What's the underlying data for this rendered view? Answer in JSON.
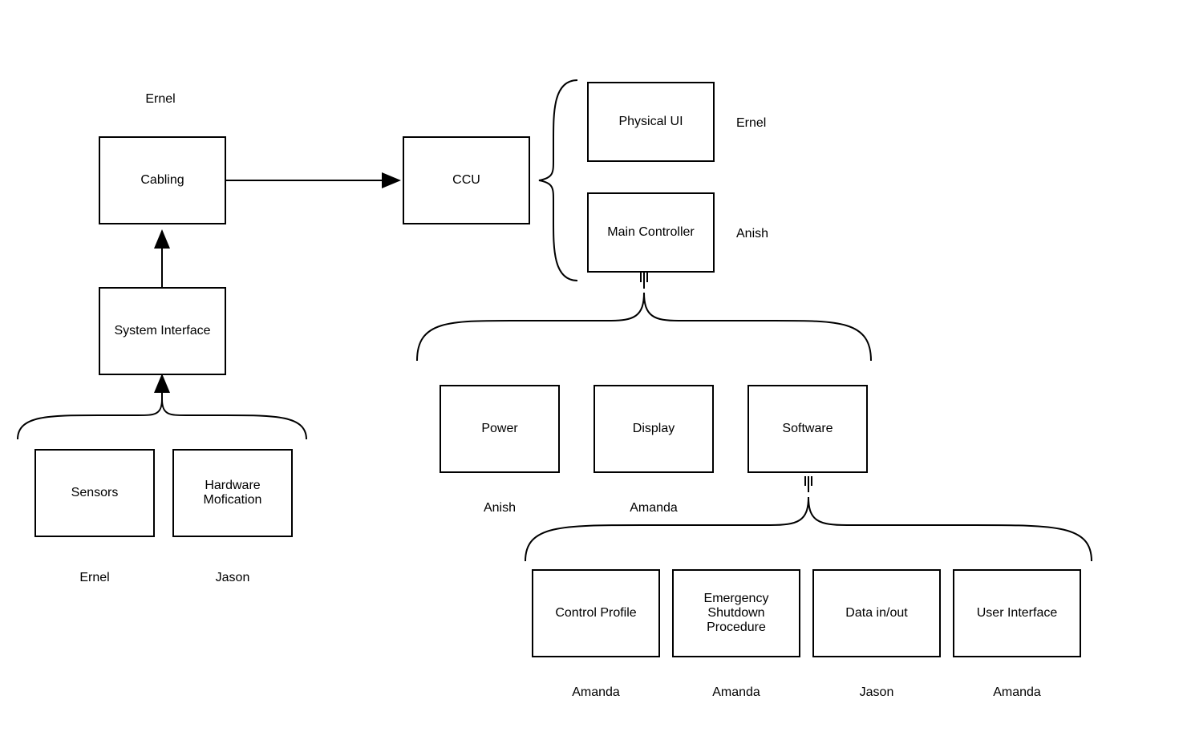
{
  "nodes": {
    "cabling": {
      "label": "Cabling",
      "owner": "Ernel"
    },
    "system_interface": {
      "label": "System Interface"
    },
    "sensors": {
      "label": "Sensors",
      "owner": "Ernel"
    },
    "hardware_mod": {
      "label": "Hardware Mofication",
      "owner": "Jason"
    },
    "ccu": {
      "label": "CCU"
    },
    "physical_ui": {
      "label": "Physical UI",
      "owner": "Ernel"
    },
    "main_controller": {
      "label": "Main Controller",
      "owner": "Anish"
    },
    "power": {
      "label": "Power",
      "owner": "Anish"
    },
    "display": {
      "label": "Display",
      "owner": "Amanda"
    },
    "software": {
      "label": "Software"
    },
    "control_profile": {
      "label": "Control Profile",
      "owner": "Amanda"
    },
    "emergency_shutdown": {
      "label": "Emergency Shutdown Procedure",
      "owner": "Amanda"
    },
    "data_in_out": {
      "label": "Data in/out",
      "owner": "Jason"
    },
    "user_interface": {
      "label": "User Interface",
      "owner": "Amanda"
    }
  }
}
